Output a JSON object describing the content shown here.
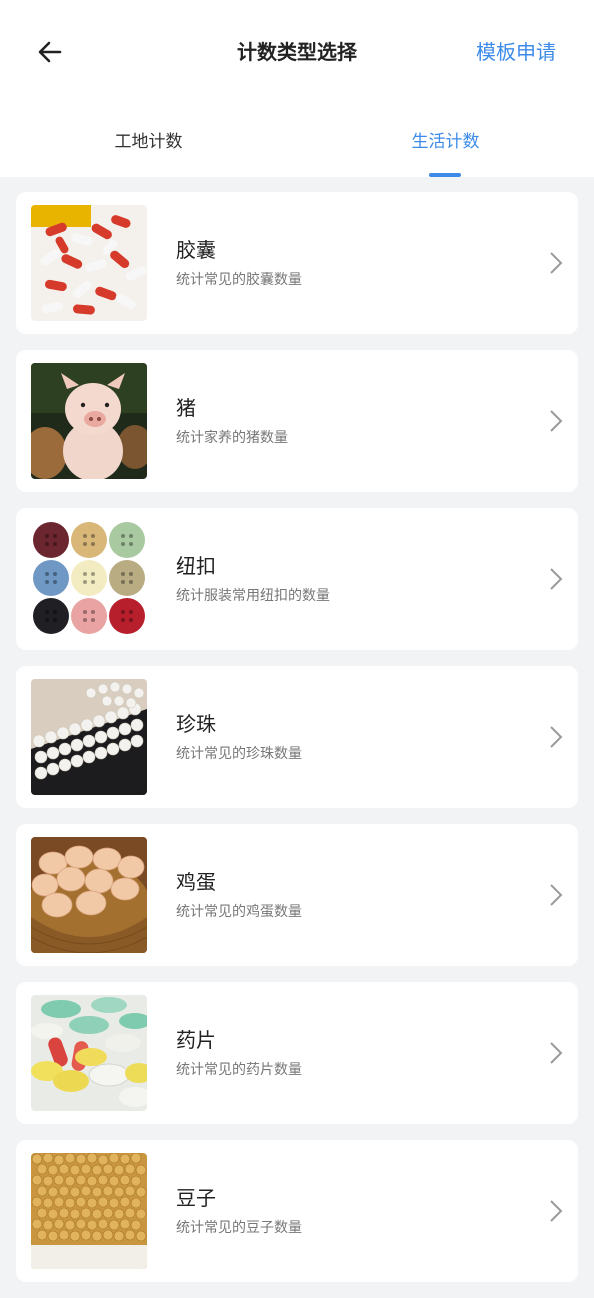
{
  "header": {
    "title": "计数类型选择",
    "action_label": "模板申请"
  },
  "tabs": [
    {
      "label": "工地计数",
      "active": false
    },
    {
      "label": "生活计数",
      "active": true
    }
  ],
  "items": [
    {
      "name": "胶囊",
      "desc": "统计常见的胶囊数量",
      "image": "capsules"
    },
    {
      "name": "猪",
      "desc": "统计家养的猪数量",
      "image": "pig"
    },
    {
      "name": "纽扣",
      "desc": "统计服装常用纽扣的数量",
      "image": "buttons"
    },
    {
      "name": "珍珠",
      "desc": "统计常见的珍珠数量",
      "image": "pearls"
    },
    {
      "name": "鸡蛋",
      "desc": "统计常见的鸡蛋数量",
      "image": "eggs"
    },
    {
      "name": "药片",
      "desc": "统计常见的药片数量",
      "image": "tablets"
    },
    {
      "name": "豆子",
      "desc": "统计常见的豆子数量",
      "image": "beans"
    }
  ],
  "colors": {
    "accent": "#3d8be8",
    "background": "#f2f3f5"
  }
}
